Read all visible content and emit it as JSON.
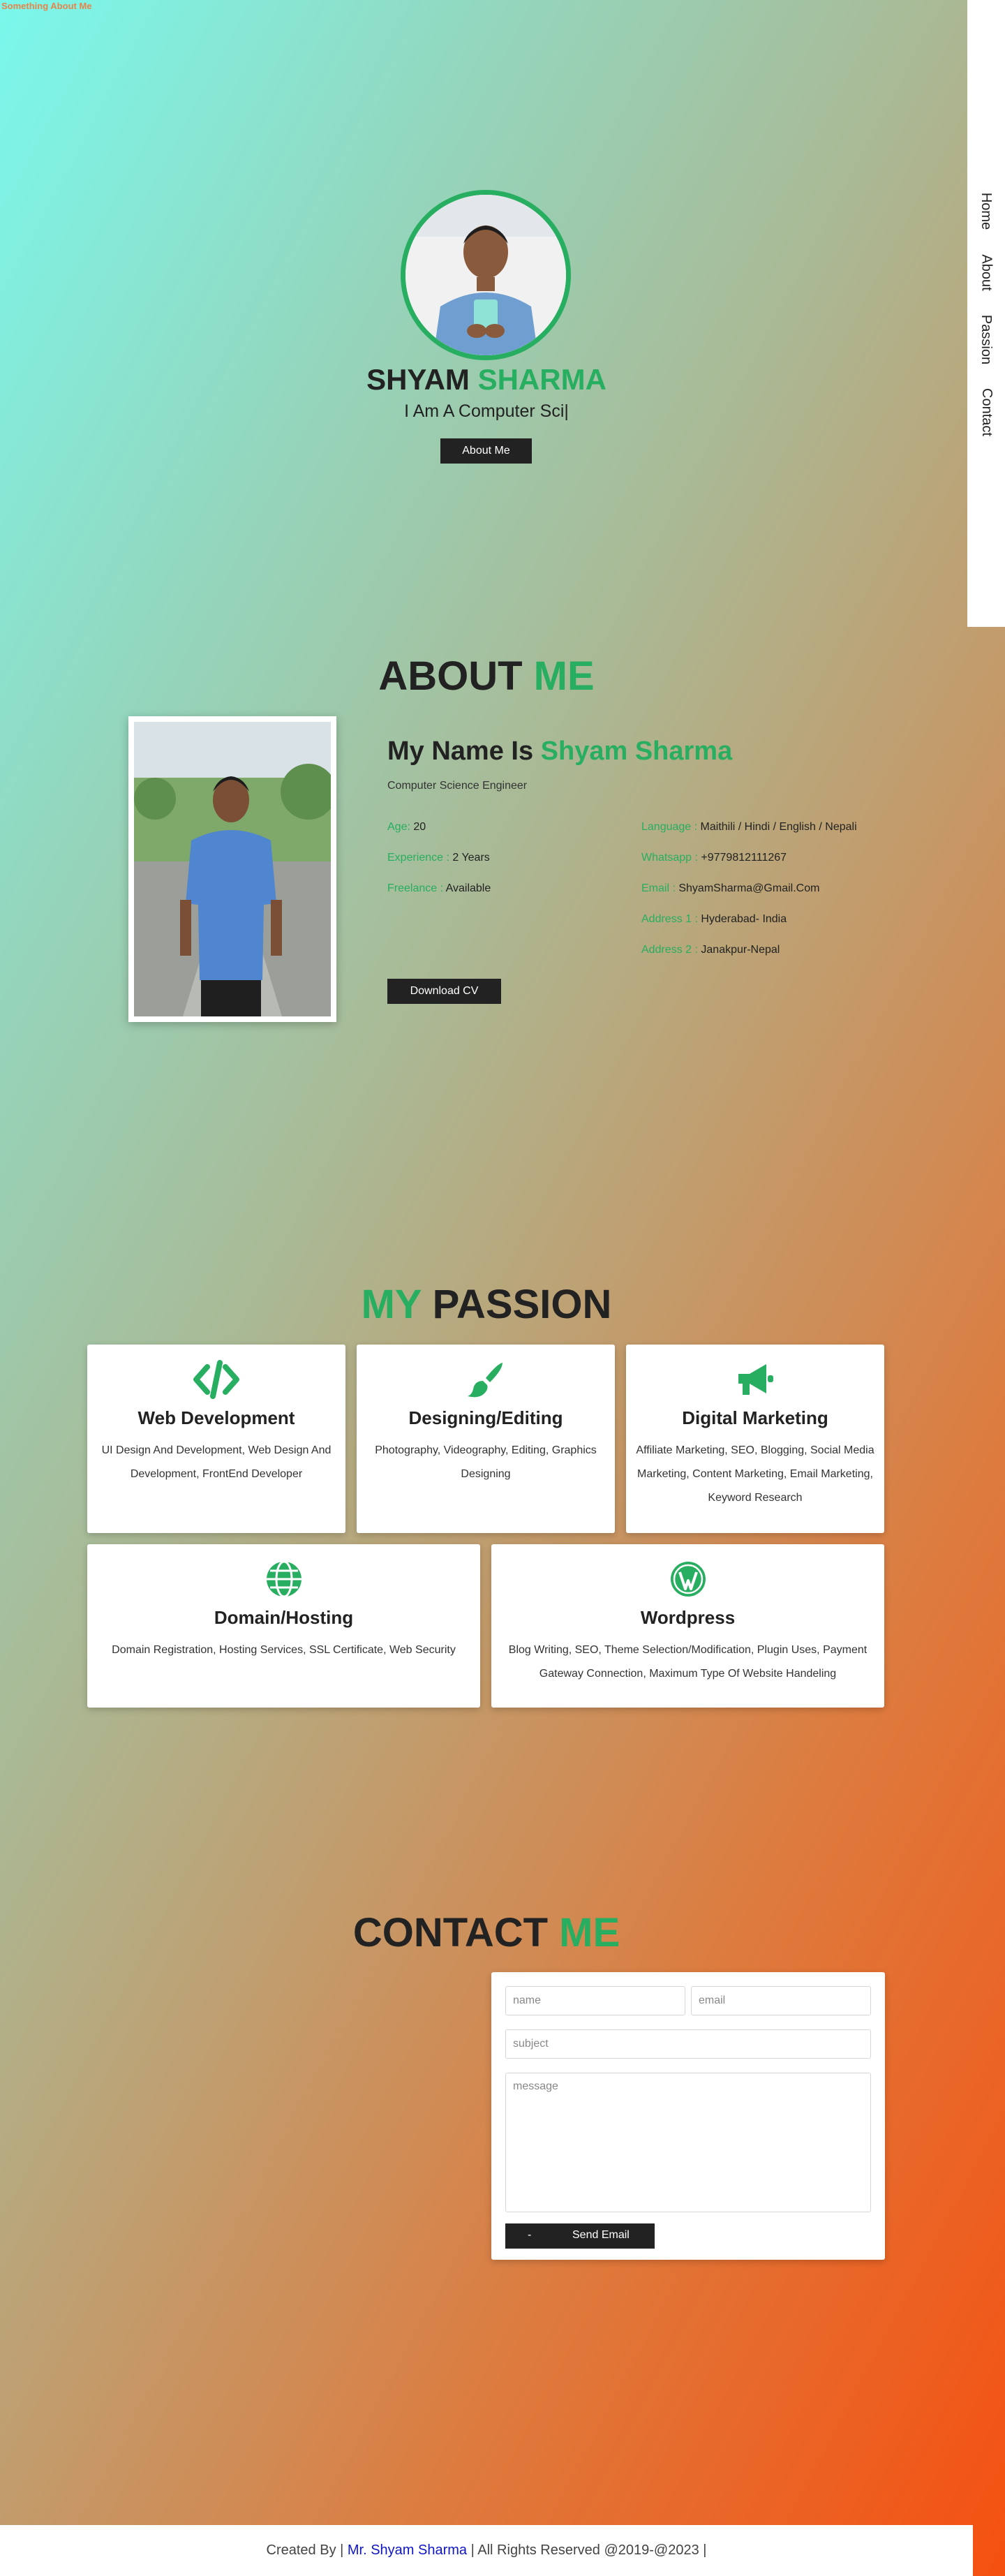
{
  "page": {
    "top_title": "Something About Me"
  },
  "nav": {
    "items": [
      "Home",
      "About",
      "Passion",
      "Contact"
    ]
  },
  "hero": {
    "first_name": "SHYAM",
    "last_name": "SHARMA",
    "subtitle": "I Am A Computer Sci|",
    "button_label": "About Me"
  },
  "about": {
    "title_main": "ABOUT",
    "title_accent": "ME",
    "heading_prefix": "My Name Is",
    "heading_name": "Shyam Sharma",
    "role": "Computer Science Engineer",
    "left_info": [
      {
        "key": "Age:",
        "value": "20"
      },
      {
        "key": "Experience :",
        "value": "2 Years"
      },
      {
        "key": "Freelance :",
        "value": "Available"
      }
    ],
    "right_info": [
      {
        "key": "Language :",
        "value": "Maithili / Hindi / English / Nepali"
      },
      {
        "key": "Whatsapp :",
        "value": "+9779812111267"
      },
      {
        "key": "Email :",
        "value": "ShyamSharma@Gmail.Com"
      },
      {
        "key": "Address 1 :",
        "value": "Hyderabad- India"
      },
      {
        "key": "Address 2 :",
        "value": "Janakpur-Nepal"
      }
    ],
    "download_label": "Download CV"
  },
  "passion": {
    "title_accent": "MY",
    "title_main": "PASSION",
    "cards": [
      {
        "icon": "code-icon",
        "title": "Web Development",
        "text": "UI Design And Development, Web Design And Development, FrontEnd Developer"
      },
      {
        "icon": "paint-brush-icon",
        "title": "Designing/Editing",
        "text": "Photography, Videography, Editing, Graphics Designing"
      },
      {
        "icon": "megaphone-icon",
        "title": "Digital Marketing",
        "text": "Affiliate Marketing, SEO, Blogging, Social Media Marketing, Content Marketing, Email Marketing, Keyword Research"
      },
      {
        "icon": "globe-icon",
        "title": "Domain/Hosting",
        "text": "Domain Registration, Hosting Services, SSL Certificate, Web Security"
      },
      {
        "icon": "wordpress-icon",
        "title": "Wordpress",
        "text": "Blog Writing, SEO, Theme Selection/Modification, Plugin Uses, Payment Gateway Connection, Maximum Type Of Website Handeling"
      }
    ]
  },
  "contact": {
    "title_main": "CONTACT",
    "title_accent": "ME",
    "name_placeholder": "name",
    "email_placeholder": "email",
    "subject_placeholder": "subject",
    "message_placeholder": "message",
    "send_prefix": "-",
    "send_label": "Send Email"
  },
  "footer": {
    "prefix": "Created By |",
    "author": "Mr. Shyam Sharma",
    "suffix": "| All Rights Reserved @2019-@2023 |"
  },
  "colors": {
    "accent": "#27ae60",
    "dark": "#222222",
    "link": "#0f16c9"
  }
}
